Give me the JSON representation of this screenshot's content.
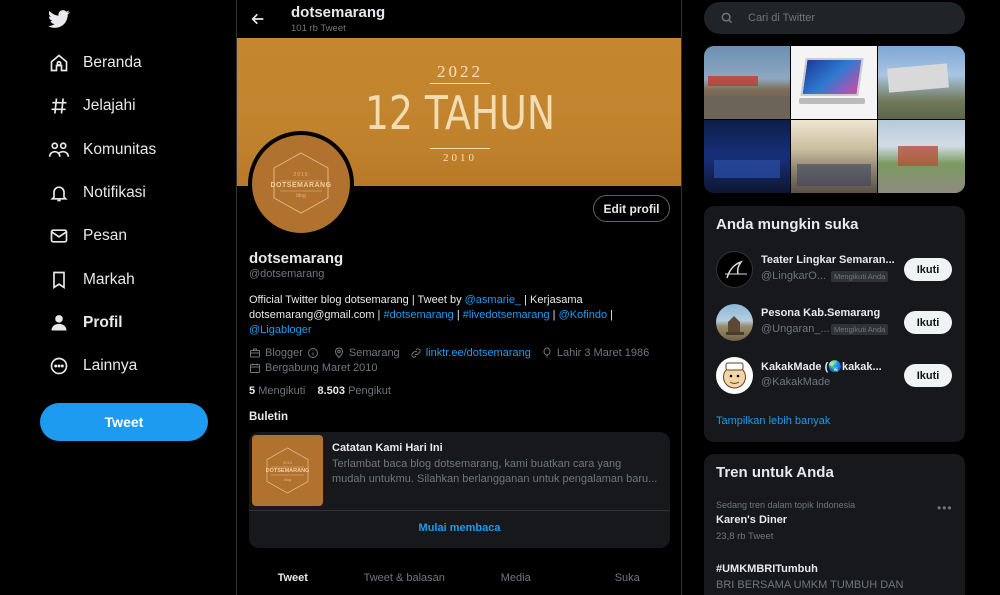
{
  "nav": {
    "items": [
      {
        "label": "Beranda",
        "icon": "home-icon"
      },
      {
        "label": "Jelajahi",
        "icon": "hashtag-icon"
      },
      {
        "label": "Komunitas",
        "icon": "communities-icon"
      },
      {
        "label": "Notifikasi",
        "icon": "bell-icon"
      },
      {
        "label": "Pesan",
        "icon": "envelope-icon"
      },
      {
        "label": "Markah",
        "icon": "bookmark-icon"
      },
      {
        "label": "Profil",
        "icon": "person-icon"
      },
      {
        "label": "Lainnya",
        "icon": "more-circle-icon"
      }
    ],
    "tweet_label": "Tweet"
  },
  "header": {
    "title": "dotsemarang",
    "tweet_count": "101 rb Tweet"
  },
  "banner": {
    "year_top": "2022",
    "headline": "12 TAHUN",
    "year_bottom": "2010"
  },
  "avatar": {
    "year": "2010",
    "brand": "DOTSEMARANG",
    "sub": "blog"
  },
  "profile": {
    "edit_label": "Edit profil",
    "name": "dotsemarang",
    "handle": "@dotsemarang",
    "bio": {
      "t1": "Official Twitter blog dotsemarang  | Tweet by ",
      "l1": "@asmarie_",
      "t2": " | Kerjasama dotsemarang@gmail.com | ",
      "l2": "#dotsemarang",
      "t3": " | ",
      "l3": "#livedotsemarang",
      "t4": " | ",
      "l4": "@Kofindo",
      "t5": " | ",
      "l5": "@Ligabloger"
    },
    "category": "Blogger",
    "location": "Semarang",
    "link": "linktr.ee/dotsemarang",
    "birth": "Lahir 3 Maret 1986",
    "joined": "Bergabung Maret 2010",
    "following_count": "5",
    "following_label": "Mengikuti",
    "followers_count": "8.503",
    "followers_label": "Pengikut"
  },
  "newsletter": {
    "heading": "Buletin",
    "title": "Catatan Kami Hari Ini",
    "desc_line1": "Terlambat baca blog dotsemarang, kami buatkan cara yang",
    "desc_line2": "mudah untukmu. Silahkan berlangganan untuk pengalaman baru...",
    "cta": "Mulai membaca"
  },
  "tabs": [
    "Tweet",
    "Tweet & balasan",
    "Media",
    "Suka"
  ],
  "search": {
    "placeholder": "Cari di Twitter"
  },
  "suggestions": {
    "heading": "Anda mungkin suka",
    "items": [
      {
        "name": "Teater Lingkar Semaran...",
        "handle": "@LingkarO...",
        "badge": "Mengikuti Anda",
        "button": "Ikuti"
      },
      {
        "name": "Pesona Kab.Semarang",
        "handle": "@Ungaran_...",
        "badge": "Mengikuti Anda",
        "button": "Ikuti"
      },
      {
        "name": "KakakMade (🌏kakak...",
        "handle": "@KakakMade",
        "badge": "",
        "button": "Ikuti"
      }
    ],
    "more": "Tampilkan lebih banyak"
  },
  "trends": {
    "heading": "Tren untuk Anda",
    "items": [
      {
        "context": "Sedang tren dalam topik Indonesia",
        "name": "Karen's Diner",
        "count": "23,8 rb Tweet"
      },
      {
        "context": "",
        "name": "#UMKMBRITumbuh",
        "count": "",
        "desc": "BRI BERSAMA UMKM TUMBUH DAN"
      }
    ]
  },
  "colors": {
    "accent": "#1d9bf0",
    "background": "#000000",
    "banner": "#c4862f",
    "panel": "#16181c"
  }
}
